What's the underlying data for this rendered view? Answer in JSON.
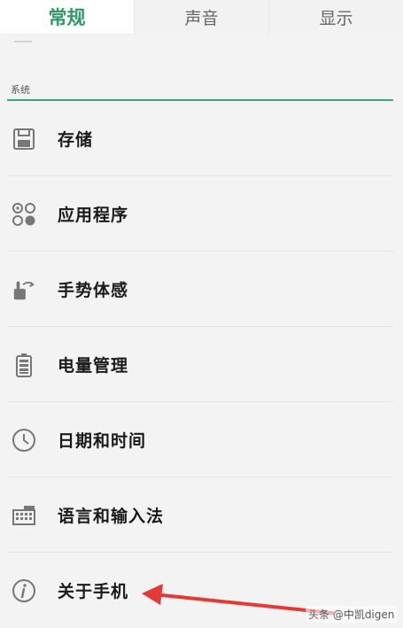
{
  "tabs": [
    {
      "label": "常规",
      "active": true
    },
    {
      "label": "声音",
      "active": false
    },
    {
      "label": "显示",
      "active": false
    }
  ],
  "section": {
    "label": "系统"
  },
  "items": [
    {
      "label": "存储",
      "icon": "storage-icon"
    },
    {
      "label": "应用程序",
      "icon": "apps-icon"
    },
    {
      "label": "手势体感",
      "icon": "gesture-icon"
    },
    {
      "label": "电量管理",
      "icon": "battery-icon"
    },
    {
      "label": "日期和时间",
      "icon": "clock-icon"
    },
    {
      "label": "语言和输入法",
      "icon": "keyboard-icon"
    },
    {
      "label": "关于手机",
      "icon": "info-icon"
    }
  ],
  "watermark": "头条 @中凯digen",
  "colors": {
    "accent": "#2e9a63",
    "arrow": "#e53935"
  }
}
